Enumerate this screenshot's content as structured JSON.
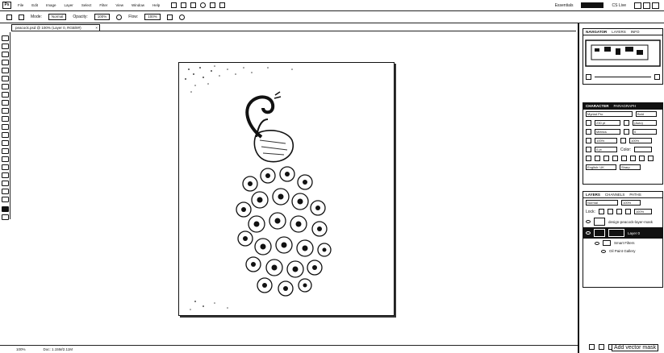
{
  "app": {
    "icon_label": "Ps"
  },
  "menubar": {
    "items": [
      "File",
      "Edit",
      "Image",
      "Layer",
      "Select",
      "Filter",
      "View",
      "Window",
      "Help"
    ],
    "workspace_label": "Essentials",
    "cs_live_label": "CS Live"
  },
  "options": {
    "mode_label": "Mode:",
    "mode_value": "Normal",
    "opacity_label": "Opacity:",
    "opacity_value": "100%",
    "flow_label": "Flow:",
    "flow_value": "100%"
  },
  "document": {
    "tab_title": "peacock.psd @ 100% (Layer 0, RGB/8#)",
    "close_glyph": "×"
  },
  "status": {
    "zoom": "100%",
    "doc_info": "Doc: 1.15M/2.11M"
  },
  "navigator": {
    "tabs": [
      "NAVIGATOR",
      "LAYERS",
      "INFO"
    ]
  },
  "character": {
    "tabs": [
      "CHARACTER",
      "PARAGRAPH"
    ],
    "font_family": "Myriad Pro",
    "font_style": "Bold",
    "size": "230 pt",
    "leading": "(Auto)",
    "kerning": "Metrics",
    "tracking": "0",
    "vscale": "100%",
    "hscale": "100%",
    "baseline": "0 pt",
    "color_label": "Color:",
    "language": "English: UK",
    "aa": "Sharp"
  },
  "layers": {
    "tabs": [
      "LAYERS",
      "CHANNELS",
      "PATHS"
    ],
    "blend": "Normal",
    "opacity": "100%",
    "lock_label": "Lock:",
    "fill": "100%",
    "items": [
      {
        "name": "design-peacock-layer-mask"
      },
      {
        "name": "Layer 0"
      },
      {
        "name": "Smart Filters"
      },
      {
        "name": "Oil Paint Gallery"
      }
    ]
  },
  "tooltip": {
    "text": "Add vector mask"
  }
}
